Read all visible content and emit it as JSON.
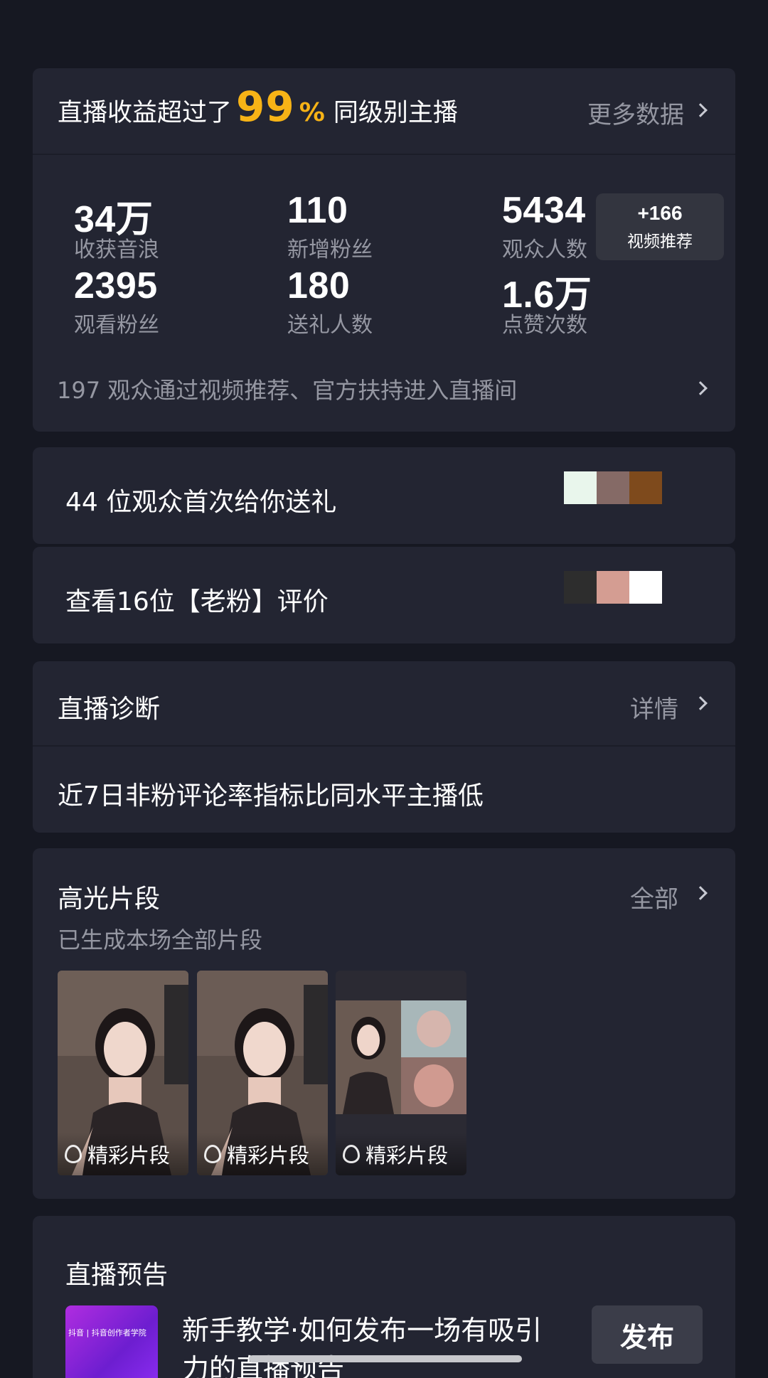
{
  "summary": {
    "prefix": "直播收益超过了",
    "percent": "99",
    "percent_sign": "%",
    "suffix": "同级别主播",
    "more_data": "更多数据",
    "stats": [
      {
        "value": "34万",
        "label": "收获音浪"
      },
      {
        "value": "110",
        "label": "新增粉丝"
      },
      {
        "value": "5434",
        "label": "观众人数"
      },
      {
        "value": "2395",
        "label": "观看粉丝"
      },
      {
        "value": "180",
        "label": "送礼人数"
      },
      {
        "value": "1.6万",
        "label": "点赞次数"
      }
    ],
    "badge": {
      "value": "+166",
      "label": "视频推荐"
    },
    "entry_note": "197 观众通过视频推荐、官方扶持进入直播间"
  },
  "first_gift": {
    "text": "44 位观众首次给你送礼",
    "swatch_colors": [
      "#e9f6ec",
      "#856a66",
      "#7e4a1c"
    ]
  },
  "old_fans": {
    "text": "查看16位【老粉】评价",
    "swatch_colors": [
      "#2d2d2d",
      "#d49d92",
      "#ffffff"
    ]
  },
  "diagnosis": {
    "title": "直播诊断",
    "detail": "详情",
    "message": "近7日非粉评论率指标比同水平主播低"
  },
  "highlights": {
    "title": "高光片段",
    "all": "全部",
    "subtitle": "已生成本场全部片段",
    "clips": [
      {
        "label": "精彩片段"
      },
      {
        "label": "精彩片段"
      },
      {
        "label": "精彩片段"
      }
    ]
  },
  "preview": {
    "title": "直播预告",
    "thumb_text": "抖音 | 抖音创作者学院",
    "description": "新手教学·如何发布一场有吸引力的直播预告",
    "button": "发布"
  },
  "colors": {
    "background": "#161822",
    "card": "#232532",
    "accent": "#f7b316",
    "muted_text": "#9597a2"
  }
}
